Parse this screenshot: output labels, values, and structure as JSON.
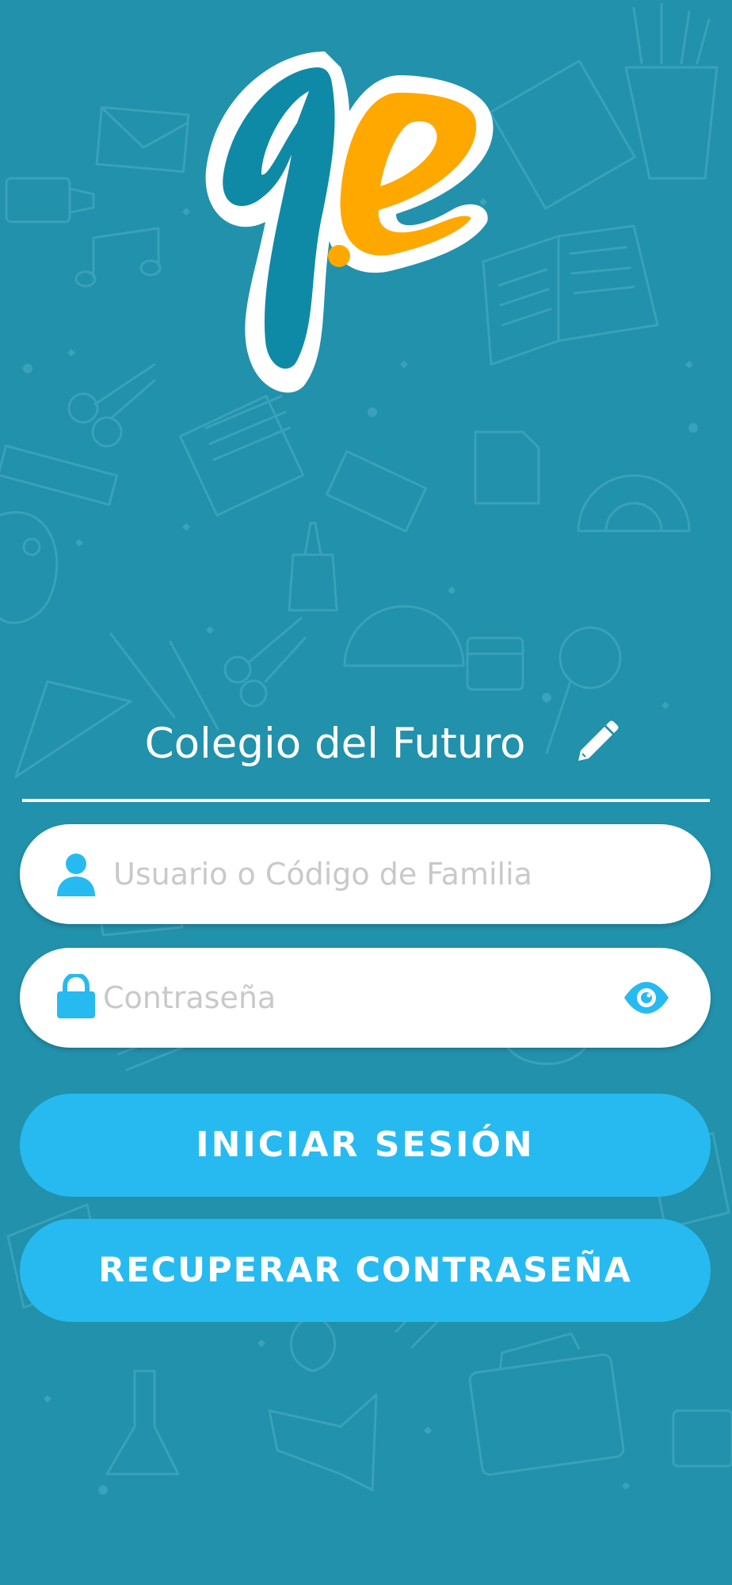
{
  "app": {
    "logo_text": "ge",
    "colors": {
      "background": "#2291ab",
      "logo_teal": "#0e8aa6",
      "logo_orange": "#ffa800",
      "accent": "#27baf0",
      "placeholder": "#c9c9c9"
    }
  },
  "school": {
    "name": "Colegio del Futuro",
    "edit_icon": "pencil-icon"
  },
  "login_form": {
    "user_field": {
      "placeholder": "Usuario o Código de Familia",
      "value": "",
      "icon": "user-icon"
    },
    "password_field": {
      "placeholder": "Contraseña",
      "value": "",
      "icon": "lock-icon",
      "toggle_icon": "eye-icon"
    },
    "login_button": "INICIAR SESIÓN",
    "recover_button": "RECUPERAR CONTRASEÑA"
  }
}
